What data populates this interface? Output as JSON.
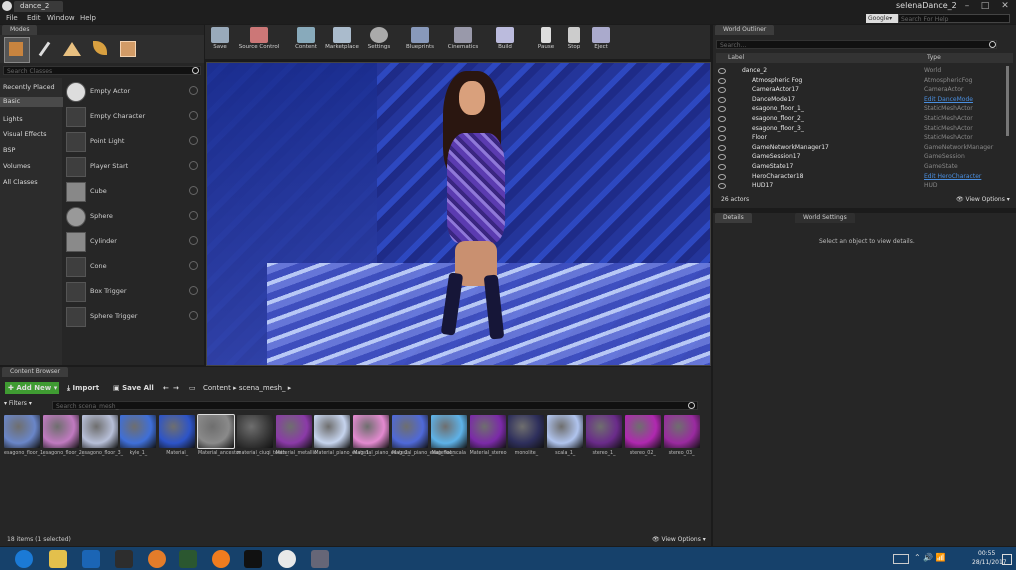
{
  "window": {
    "doc_tab": "dance_2",
    "project_name": "selenaDance_2",
    "menu": [
      "File",
      "Edit",
      "Window",
      "Help"
    ],
    "search_provider": "Google",
    "search_placeholder": "Search For Help"
  },
  "modes": {
    "tab_label": "Modes",
    "search_placeholder": "Search Classes",
    "categories": [
      "Recently Placed",
      "Basic",
      "Lights",
      "Visual Effects",
      "BSP",
      "Volumes",
      "All Classes"
    ],
    "active_category": "Basic",
    "items": [
      "Empty Actor",
      "Empty Character",
      "Point Light",
      "Player Start",
      "Cube",
      "Sphere",
      "Cylinder",
      "Cone",
      "Box Trigger",
      "Sphere Trigger"
    ]
  },
  "toolbar": {
    "buttons": [
      "Save",
      "Source Control",
      "Content",
      "Marketplace",
      "Settings",
      "Blueprints",
      "Cinematics",
      "Build",
      "Pause",
      "Stop",
      "Eject"
    ]
  },
  "outliner": {
    "tab_label": "World Outliner",
    "search_placeholder": "Search...",
    "col_label": "Label",
    "col_type": "Type",
    "rows": [
      {
        "label": "dance_2",
        "type": "World",
        "link": false
      },
      {
        "label": "Atmospheric Fog",
        "type": "AtmosphericFog",
        "link": false
      },
      {
        "label": "CameraActor17",
        "type": "CameraActor",
        "link": false
      },
      {
        "label": "DanceMode17",
        "type": "Edit DanceMode",
        "link": true
      },
      {
        "label": "esagono_floor_1_",
        "type": "StaticMeshActor",
        "link": false
      },
      {
        "label": "esagono_floor_2_",
        "type": "StaticMeshActor",
        "link": false
      },
      {
        "label": "esagono_floor_3_",
        "type": "StaticMeshActor",
        "link": false
      },
      {
        "label": "Floor",
        "type": "StaticMeshActor",
        "link": false
      },
      {
        "label": "GameNetworkManager17",
        "type": "GameNetworkManager",
        "link": false
      },
      {
        "label": "GameSession17",
        "type": "GameSession",
        "link": false
      },
      {
        "label": "GameState17",
        "type": "GameState",
        "link": false
      },
      {
        "label": "HeroCharacter18",
        "type": "Edit HeroCharacter",
        "link": true
      },
      {
        "label": "HUD17",
        "type": "HUD",
        "link": false
      }
    ],
    "actor_count": "26 actors",
    "view_options": "View Options"
  },
  "details": {
    "tab_label": "Details",
    "tab2_label": "World Settings",
    "empty_message": "Select an object to view details."
  },
  "content_browser": {
    "tab_label": "Content Browser",
    "add_new": "Add New",
    "import": "Import",
    "save_all": "Save All",
    "path": [
      "Content",
      "scena_mesh_"
    ],
    "filters": "Filters",
    "search_placeholder": "Search scena_mesh_",
    "assets": [
      {
        "label": "esagono_floor_1_",
        "color": "#6a86c8"
      },
      {
        "label": "esagono_floor_2_",
        "color": "#c07ac0"
      },
      {
        "label": "esagono_floor_3_",
        "color": "#b7bfd8"
      },
      {
        "label": "kyle_1_",
        "color": "#3f6fd8"
      },
      {
        "label": "Material_",
        "color": "#2d54c8"
      },
      {
        "label": "Material_ancestor",
        "color": "#8a8a8a"
      },
      {
        "label": "material_ciuqi_teeth_",
        "color": "#3a3a3a"
      },
      {
        "label": "Material_metallic",
        "color": "#8b3aa8"
      },
      {
        "label": "Material_piano_esag_1_",
        "color": "#c6d4ee"
      },
      {
        "label": "Material_piano_esag_2_",
        "color": "#e38ad0"
      },
      {
        "label": "Material_piano_esag_floor",
        "color": "#4f69d8"
      },
      {
        "label": "Material_scala",
        "color": "#5eb2e8"
      },
      {
        "label": "Material_stereo",
        "color": "#7b2aa8"
      },
      {
        "label": "monolite_",
        "color": "#2e2f5c"
      },
      {
        "label": "scala_1_",
        "color": "#b0c4ee"
      },
      {
        "label": "stereo_1_",
        "color": "#6a2b8a"
      },
      {
        "label": "stereo_02_",
        "color": "#b028b0"
      },
      {
        "label": "stereo_03_",
        "color": "#9a2aa0"
      }
    ],
    "item_count": "18 items (1 selected)",
    "view_options": "View Options"
  },
  "taskbar": {
    "time": "00:55",
    "date": "28/11/2017"
  }
}
